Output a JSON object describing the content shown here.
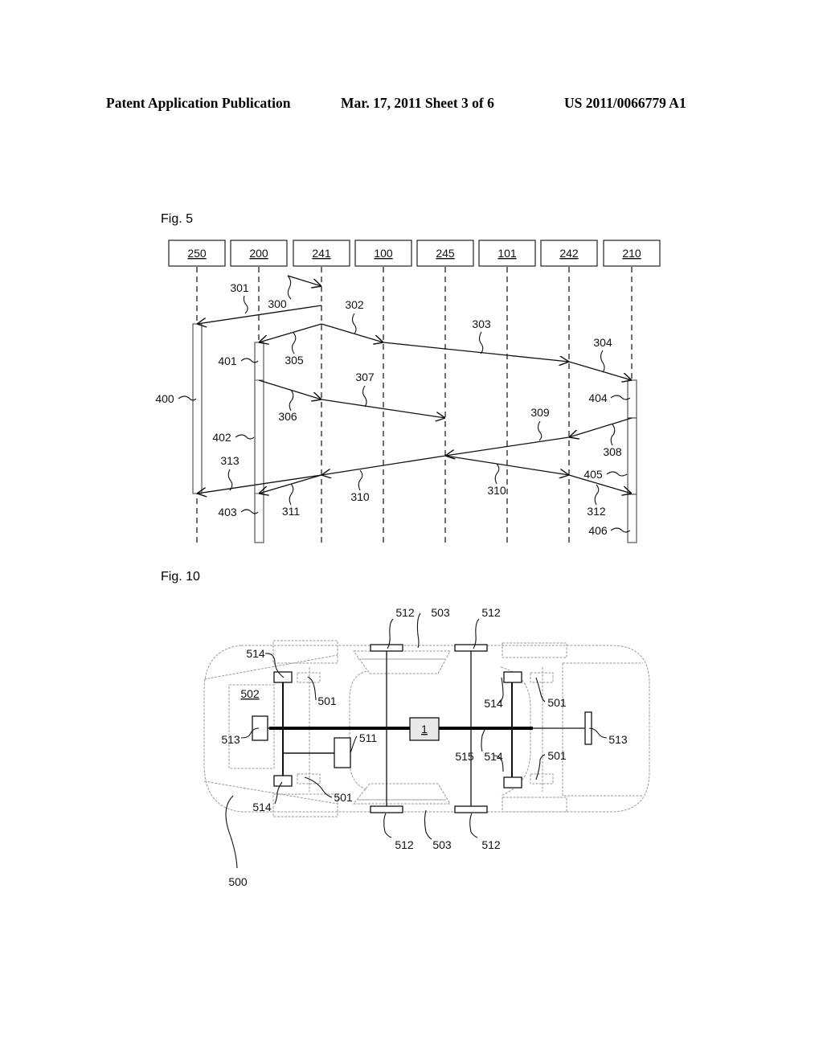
{
  "header": {
    "left": "Patent Application Publication",
    "center": "Mar. 17, 2011  Sheet 3 of 6",
    "right": "US 2011/0066779 A1"
  },
  "fig5": {
    "title": "Fig. 5",
    "entities": [
      "250",
      "200",
      "241",
      "100",
      "245",
      "101",
      "242",
      "210"
    ],
    "messages": [
      {
        "id": "300",
        "label": "300"
      },
      {
        "id": "301",
        "label": "301"
      },
      {
        "id": "302",
        "label": "302"
      },
      {
        "id": "303",
        "label": "303"
      },
      {
        "id": "304",
        "label": "304"
      },
      {
        "id": "305",
        "label": "305"
      },
      {
        "id": "306",
        "label": "306"
      },
      {
        "id": "307",
        "label": "307"
      },
      {
        "id": "308",
        "label": "308"
      },
      {
        "id": "309",
        "label": "309"
      },
      {
        "id": "310a",
        "label": "310"
      },
      {
        "id": "310b",
        "label": "310"
      },
      {
        "id": "311",
        "label": "311"
      },
      {
        "id": "312",
        "label": "312"
      },
      {
        "id": "313",
        "label": "313"
      }
    ],
    "activations": [
      "400",
      "401",
      "402",
      "403",
      "404",
      "405",
      "406"
    ]
  },
  "fig10": {
    "title": "Fig. 10",
    "labels": {
      "vehicle": "500",
      "wheel_module_tl": "501",
      "wheel_module_bl": "501",
      "wheel_module_tr": "501",
      "wheel_module_br": "501",
      "compartment": "502",
      "door_top": "503",
      "door_bottom": "503",
      "unit": "511",
      "sensor_tl": "512",
      "sensor_tr": "512",
      "sensor_bl": "512",
      "sensor_br": "512",
      "end_left": "513",
      "end_right": "513",
      "actuator_tl": "514",
      "actuator_bl": "514",
      "actuator_tr": "514",
      "actuator_br": "514",
      "bus": "515",
      "central": "1"
    }
  }
}
